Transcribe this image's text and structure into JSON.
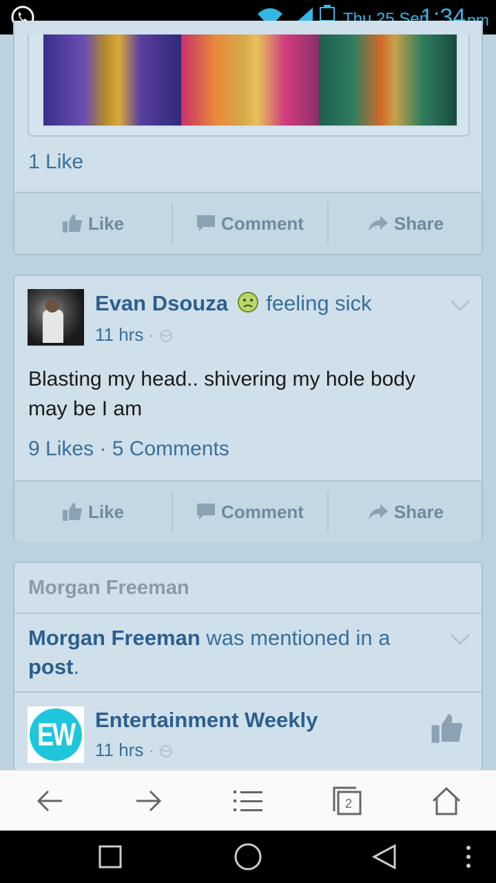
{
  "status_bar": {
    "date": "Thu 25 Sep",
    "time": "1:34",
    "ampm": "pm",
    "icons": [
      "whatsapp-icon",
      "wifi-icon",
      "signal-icon",
      "battery-icon"
    ]
  },
  "post1": {
    "likes_text": "1 Like",
    "actions": {
      "like": "Like",
      "comment": "Comment",
      "share": "Share"
    }
  },
  "post2": {
    "author": "Evan Dsouza",
    "feeling": "feeling sick",
    "time": "11 hrs",
    "separator": "·",
    "text": "Blasting my head.. shivering my hole body may be I am",
    "likes": "9 Likes",
    "dot": " · ",
    "comments": "5 Comments",
    "actions": {
      "like": "Like",
      "comment": "Comment",
      "share": "Share"
    }
  },
  "post3": {
    "header": "Morgan Freeman",
    "mention_name": "Morgan Freeman",
    "mention_mid": " was mentioned in a ",
    "mention_post": "post",
    "mention_end": ".",
    "page_name": "Entertainment Weekly",
    "page_logo_text": "EW",
    "time": "11 hrs",
    "separator": "·"
  },
  "browser_bar": {
    "tab_count": "2"
  },
  "colors": {
    "accent": "#33b5e5",
    "link": "#2d5f8e",
    "card_bg": "#cfe0ea",
    "page_bg": "#bcd2df",
    "ew_cyan": "#1ec6dc"
  }
}
